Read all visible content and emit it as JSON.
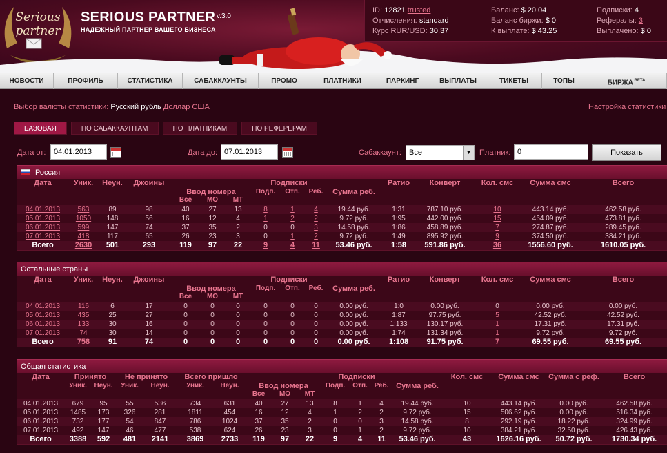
{
  "header": {
    "logo_text": "Serious partner",
    "brand": "SERIOUS PARTNER",
    "version": "v.3.0",
    "tagline": "НАДЕЖНЫЙ ПАРТНЕР ВАШЕГО БИЗНЕСА"
  },
  "account": {
    "id_label": "ID:",
    "id_value": "12821",
    "trusted": "trusted",
    "deduction_label": "Отчисления:",
    "deduction_value": "standard",
    "rate_label": "Курс RUR/USD:",
    "rate_value": "30.37",
    "balance_label": "Баланс:",
    "balance_value": "$ 20.04",
    "exchange_label": "Баланс биржи:",
    "exchange_value": "$ 0",
    "payout_label": "К выплате:",
    "payout_value": "$ 43.25",
    "subs_label": "Подписки:",
    "subs_value": "4",
    "refs_label": "Рефералы:",
    "refs_value": "3",
    "paid_label": "Выплачено:",
    "paid_value": "$ 0"
  },
  "nav": [
    {
      "label": "НОВОСТИ",
      "w": 78
    },
    {
      "label": "ПРОФИЛЬ",
      "w": 93
    },
    {
      "label": "СТАТИСТИКА",
      "w": 94
    },
    {
      "label": "САБАККАУНТЫ",
      "w": 110
    },
    {
      "label": "ПРОМО",
      "w": 75
    },
    {
      "label": "ПЛАТНИКИ",
      "w": 94
    },
    {
      "label": "ПАРКИНГ",
      "w": 80
    },
    {
      "label": "ВЫПЛАТЫ",
      "w": 81
    },
    {
      "label": "ТИКЕТЫ",
      "w": 81
    },
    {
      "label": "ТОПЫ",
      "w": 64
    },
    {
      "label": "БИРЖА",
      "w": 117
    }
  ],
  "nav_beta": "BETA",
  "currency": {
    "label": "Выбор валюты статистики:",
    "current": "Русский рубль",
    "alt": "Доллар США",
    "settings": "Настройка статистики"
  },
  "tabs": [
    "БАЗОВАЯ",
    "ПО САБАККАУНТАМ",
    "ПО ПЛАТНИКАМ",
    "ПО РЕФЕРЕРАМ"
  ],
  "filters": {
    "date_from_label": "Дата от:",
    "date_from": "04.01.2013",
    "date_to_label": "Дата до:",
    "date_to": "07.01.2013",
    "subaccount_label": "Сабаккаунт:",
    "subaccount": "Все",
    "payer_label": "Платник:",
    "payer": "0",
    "show_button": "Показать"
  },
  "common_headers": {
    "date": "Дата",
    "uniq": "Уник.",
    "nonuniq": "Неун.",
    "joins": "Джоины",
    "number_input": "Ввод номера",
    "all": "Все",
    "mo": "МО",
    "mt": "МТ",
    "subs": "Подписки",
    "sub": "Подп.",
    "unsub": "Отп.",
    "reb": "Реб.",
    "reb_sum": "Сумма реб.",
    "ratio": "Ратио",
    "conv": "Конверт",
    "sms_count": "Кол. смс",
    "sms_sum": "Сумма смс",
    "total": "Всего",
    "accepted": "Принято",
    "not_accepted": "Не принято",
    "total_came": "Всего пришло",
    "ref_sum": "Сумма с реф."
  },
  "russia": {
    "title": "Россия",
    "rows": [
      [
        "04.01.2013",
        "563",
        "89",
        "98",
        "40",
        "27",
        "13",
        "8",
        "1",
        "4",
        "19.44 руб.",
        "1:31",
        "787.10 руб.",
        "10",
        "443.14 руб.",
        "462.58 руб."
      ],
      [
        "05.01.2013",
        "1050",
        "148",
        "56",
        "16",
        "12",
        "4",
        "1",
        "2",
        "2",
        "9.72 руб.",
        "1:95",
        "442.00 руб.",
        "15",
        "464.09 руб.",
        "473.81 руб."
      ],
      [
        "06.01.2013",
        "599",
        "147",
        "74",
        "37",
        "35",
        "2",
        "0",
        "0",
        "3",
        "14.58 руб.",
        "1:86",
        "458.89 руб.",
        "7",
        "274.87 руб.",
        "289.45 руб."
      ],
      [
        "07.01.2013",
        "418",
        "117",
        "65",
        "26",
        "23",
        "3",
        "0",
        "1",
        "2",
        "9.72 руб.",
        "1:49",
        "895.92 руб.",
        "9",
        "374.50 руб.",
        "384.21 руб."
      ]
    ],
    "total": [
      "Всего",
      "2630",
      "501",
      "293",
      "119",
      "97",
      "22",
      "9",
      "4",
      "11",
      "53.46 руб.",
      "1:58",
      "591.86 руб.",
      "36",
      "1556.60 руб.",
      "1610.05 руб."
    ]
  },
  "others": {
    "title": "Остальные страны",
    "rows": [
      [
        "04.01.2013",
        "116",
        "6",
        "17",
        "0",
        "0",
        "0",
        "0",
        "0",
        "0",
        "0.00 руб.",
        "1:0",
        "0.00 руб.",
        "0",
        "0.00 руб.",
        "0.00 руб."
      ],
      [
        "05.01.2013",
        "435",
        "25",
        "27",
        "0",
        "0",
        "0",
        "0",
        "0",
        "0",
        "0.00 руб.",
        "1:87",
        "97.75 руб.",
        "5",
        "42.52 руб.",
        "42.52 руб."
      ],
      [
        "06.01.2013",
        "133",
        "30",
        "16",
        "0",
        "0",
        "0",
        "0",
        "0",
        "0",
        "0.00 руб.",
        "1:133",
        "130.17 руб.",
        "1",
        "17.31 руб.",
        "17.31 руб."
      ],
      [
        "07.01.2013",
        "74",
        "30",
        "14",
        "0",
        "0",
        "0",
        "0",
        "0",
        "0",
        "0.00 руб.",
        "1:74",
        "131.34 руб.",
        "1",
        "9.72 руб.",
        "9.72 руб."
      ]
    ],
    "total": [
      "Всего",
      "758",
      "91",
      "74",
      "0",
      "0",
      "0",
      "0",
      "0",
      "0",
      "0.00 руб.",
      "1:108",
      "91.75 руб.",
      "7",
      "69.55 руб.",
      "69.55 руб."
    ]
  },
  "general": {
    "title": "Общая статистика",
    "rows": [
      [
        "04.01.2013",
        "679",
        "95",
        "55",
        "536",
        "734",
        "631",
        "40",
        "27",
        "13",
        "8",
        "1",
        "4",
        "19.44 руб.",
        "10",
        "443.14 руб.",
        "0.00 руб.",
        "462.58 руб."
      ],
      [
        "05.01.2013",
        "1485",
        "173",
        "326",
        "281",
        "1811",
        "454",
        "16",
        "12",
        "4",
        "1",
        "2",
        "2",
        "9.72 руб.",
        "15",
        "506.62 руб.",
        "0.00 руб.",
        "516.34 руб."
      ],
      [
        "06.01.2013",
        "732",
        "177",
        "54",
        "847",
        "786",
        "1024",
        "37",
        "35",
        "2",
        "0",
        "0",
        "3",
        "14.58 руб.",
        "8",
        "292.19 руб.",
        "18.22 руб.",
        "324.99 руб."
      ],
      [
        "07.01.2013",
        "492",
        "147",
        "46",
        "477",
        "538",
        "624",
        "26",
        "23",
        "3",
        "0",
        "1",
        "2",
        "9.72 руб.",
        "10",
        "384.21 руб.",
        "32.50 руб.",
        "426.43 руб."
      ]
    ],
    "total": [
      "Всего",
      "3388",
      "592",
      "481",
      "2141",
      "3869",
      "2733",
      "119",
      "97",
      "22",
      "9",
      "4",
      "11",
      "53.46 руб.",
      "43",
      "1626.16 руб.",
      "50.72 руб.",
      "1730.34 руб."
    ]
  }
}
